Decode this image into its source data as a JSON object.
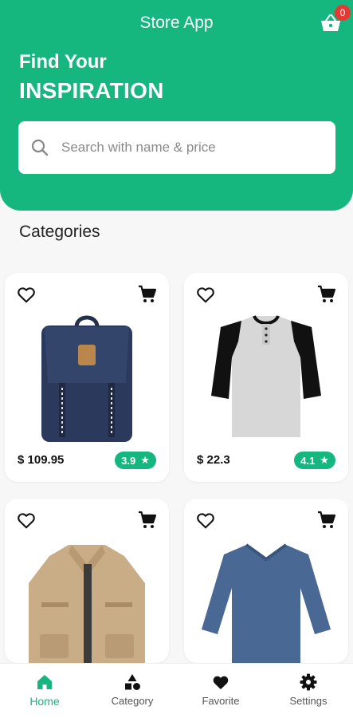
{
  "header": {
    "app_title": "Store App",
    "cart_count": "0",
    "headline_line1": "Find Your",
    "headline_line2": "INSPIRATION"
  },
  "search": {
    "placeholder": "Search with name & price"
  },
  "section_title": "Categories",
  "products": [
    {
      "price": "$ 109.95",
      "rating": "3.9",
      "image": "backpack"
    },
    {
      "price": "$ 22.3",
      "rating": "4.1",
      "image": "raglan-shirt"
    },
    {
      "image": "jacket"
    },
    {
      "image": "long-sleeve-shirt"
    }
  ],
  "bottom_nav": [
    {
      "label": "Home",
      "icon": "home-icon",
      "active": true
    },
    {
      "label": "Category",
      "icon": "category-icon"
    },
    {
      "label": "Favorite",
      "icon": "heart-icon"
    },
    {
      "label": "Settings",
      "icon": "gear-icon"
    }
  ],
  "colors": {
    "accent": "#16b67f",
    "badge": "#e53935"
  }
}
